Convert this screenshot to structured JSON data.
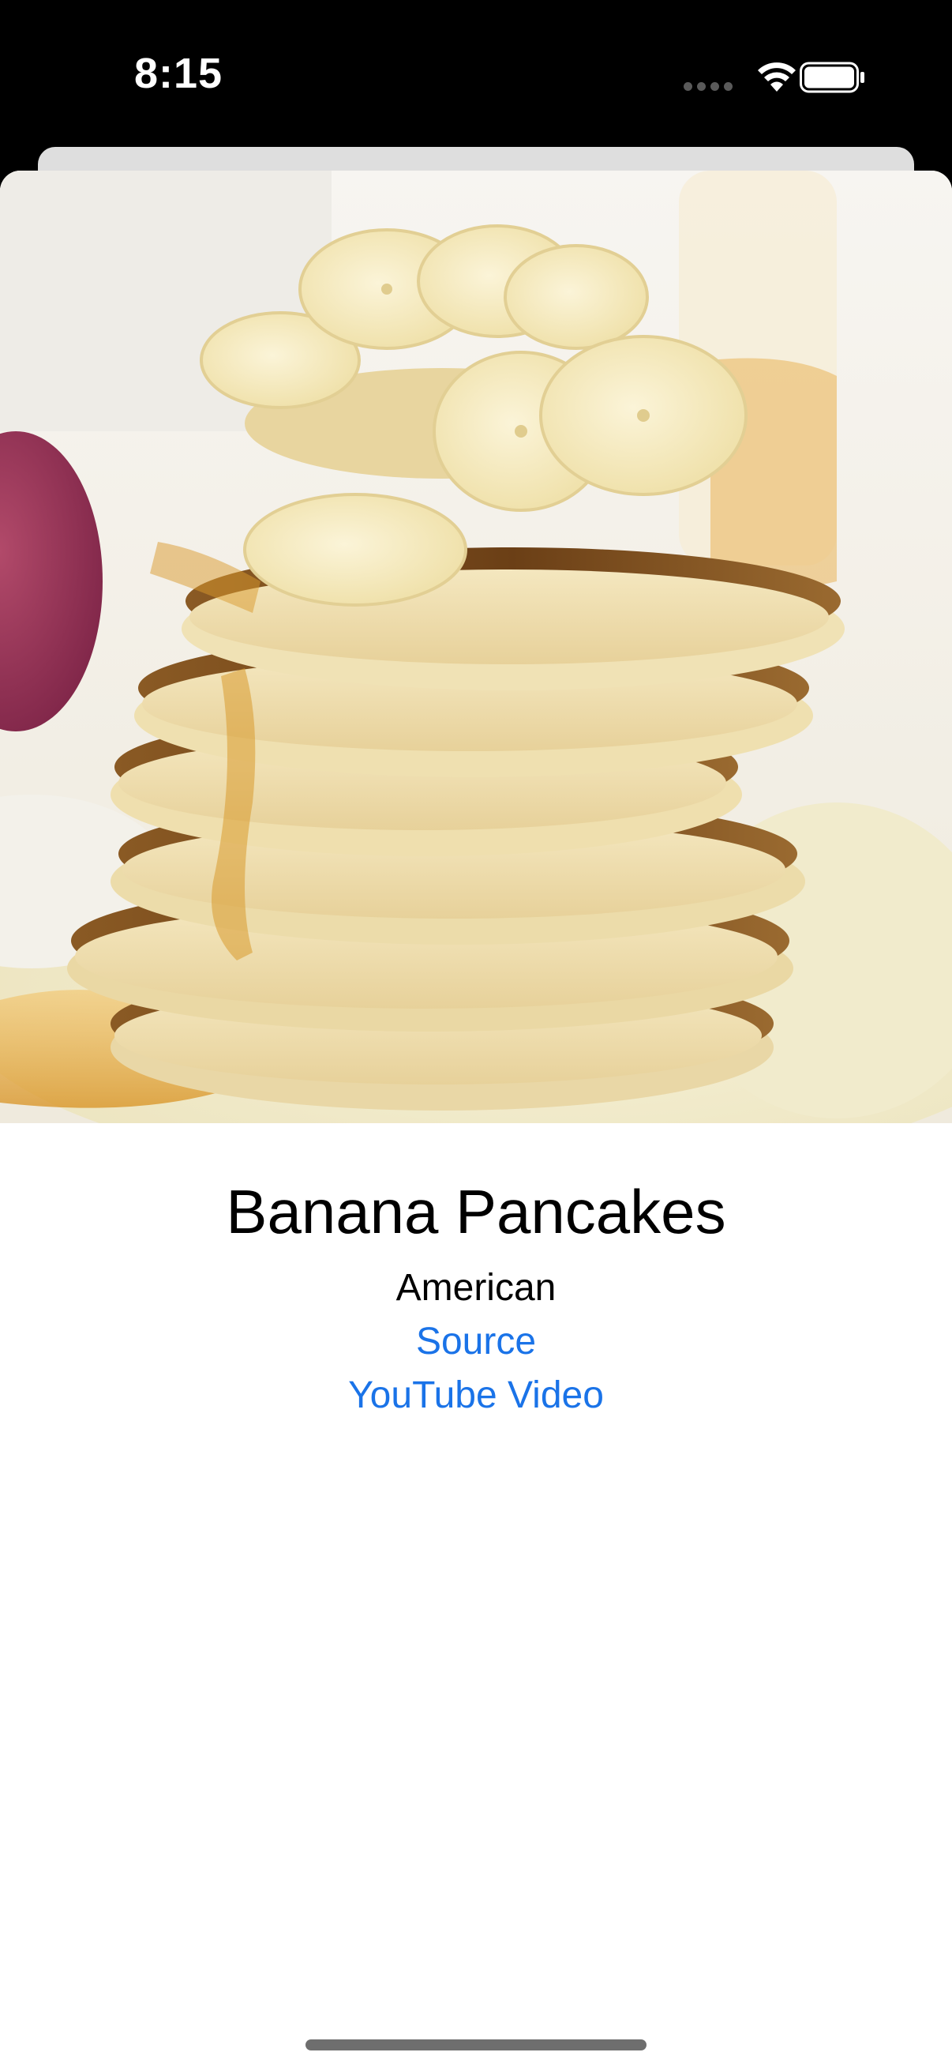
{
  "status_bar": {
    "time": "8:15",
    "icons": [
      "cellular-dots-icon",
      "wifi-icon",
      "battery-icon"
    ]
  },
  "meal": {
    "image_icon": "banana-pancakes-photo",
    "title": "Banana Pancakes",
    "area": "American",
    "source_label": "Source",
    "video_label": "YouTube Video"
  },
  "colors": {
    "link": "#1a73e8",
    "status_bar_bg": "#000000",
    "sheet_bg": "#ffffff"
  }
}
